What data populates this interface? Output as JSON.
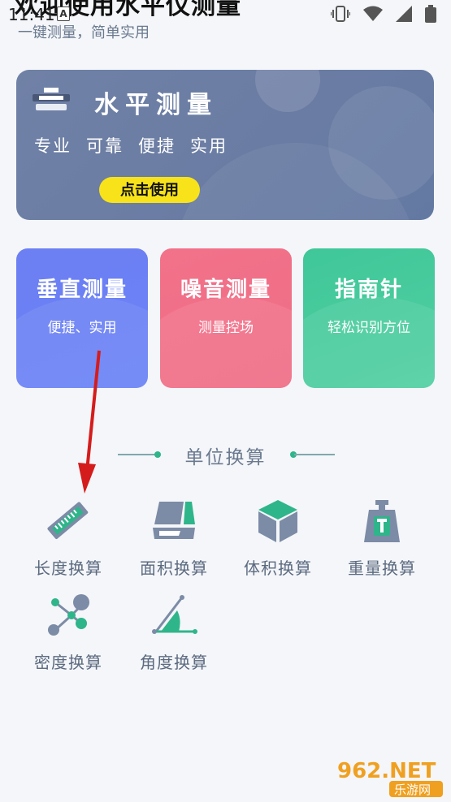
{
  "status": {
    "time": "11:41",
    "badge": "A"
  },
  "header": {
    "title": "欢迎使用水平仪测量",
    "subtitle": "一键测量，简单实用"
  },
  "banner": {
    "title": "水平测量",
    "tags": [
      "专业",
      "可靠",
      "便捷",
      "实用"
    ],
    "button_label": "点击使用"
  },
  "cards": [
    {
      "title": "垂直测量",
      "subtitle": "便捷、实用",
      "color": "#6c7ff3"
    },
    {
      "title": "噪音测量",
      "subtitle": "测量控场",
      "color": "#f2728a"
    },
    {
      "title": "指南针",
      "subtitle": "轻松识别方位",
      "color": "#3fc799"
    }
  ],
  "units": {
    "section_title": "单位换算",
    "items": [
      {
        "label": "长度换算",
        "icon": "ruler-icon"
      },
      {
        "label": "面积换算",
        "icon": "area-icon"
      },
      {
        "label": "体积换算",
        "icon": "cube-icon"
      },
      {
        "label": "重量换算",
        "icon": "weight-icon"
      },
      {
        "label": "密度换算",
        "icon": "density-icon"
      },
      {
        "label": "角度换算",
        "icon": "angle-icon"
      }
    ]
  },
  "watermark": {
    "brand": "962.NET",
    "sub": "乐游网"
  },
  "colors": {
    "accent_green": "#2fb58a",
    "icon_slate": "#7c8ba6",
    "button_yellow": "#f8e31a"
  }
}
